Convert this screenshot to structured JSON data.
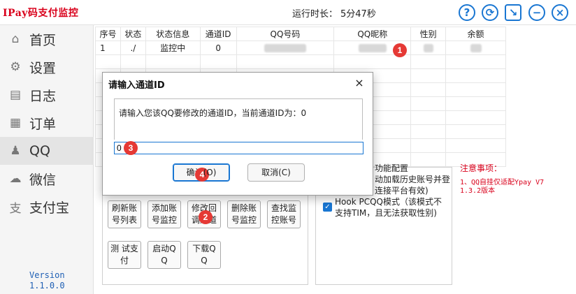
{
  "header": {
    "app_title": "IPay码支付监控",
    "runtime_label": "运行时长：",
    "runtime_value": "5分47秒",
    "buttons": {
      "help": "?",
      "refresh": "⟳",
      "minimize_tray": "↘",
      "minimize": "−",
      "close": "×"
    }
  },
  "sidebar": {
    "items": [
      {
        "label": "首页",
        "icon": "home-icon",
        "glyph": "⌂"
      },
      {
        "label": "设置",
        "icon": "gear-icon",
        "glyph": "⚙"
      },
      {
        "label": "日志",
        "icon": "log-icon",
        "glyph": "▤"
      },
      {
        "label": "订单",
        "icon": "order-icon",
        "glyph": "▦"
      },
      {
        "label": "QQ",
        "icon": "qq-icon",
        "glyph": "♟"
      },
      {
        "label": "微信",
        "icon": "wechat-icon",
        "glyph": "☁"
      },
      {
        "label": "支付宝",
        "icon": "alipay-icon",
        "glyph": "支"
      }
    ],
    "version_label": "Version",
    "version_value": "1.1.0.0"
  },
  "table": {
    "headers": [
      "序号",
      "状态",
      "状态信息",
      "通道ID",
      "QQ号码",
      "QQ昵称",
      "性别",
      "余额"
    ],
    "rows": [
      {
        "index": "1",
        "status": "./",
        "status_info": "监控中",
        "channel_id": "0"
      }
    ]
  },
  "actions": {
    "refresh_list": "刷新账号列表",
    "add_monitor": "添加账号监控",
    "modify_channel": "修改回调通道",
    "delete_monitor": "删除账号监控",
    "find_monitor": "查找监控账号",
    "test_pay": "测 试支 付",
    "start_qq": "启动Q Q",
    "download_qq": "下载Q Q"
  },
  "options": {
    "section_title": "功能配置",
    "auto_load_text": "动加载历史账号并登",
    "auto_load_text2": "连接平台有效)",
    "hook_text": "Hook PCQQ模式（该模式不支持TIM，且无法获取性别)"
  },
  "notes": {
    "title": "注意事项：",
    "body": "1、QQ自挂仅适配Ypay V7 1.3.2版本"
  },
  "dialog": {
    "title": "请输入通道ID",
    "close": "×",
    "message": "请输入您该QQ要修改的通道ID，当前通道ID为：0",
    "input_value": "0",
    "ok_label": "确认(O)",
    "ok_short": "确认",
    "ok_suffix": "(O)",
    "cancel_label": "取消(C)"
  },
  "badges": [
    "1",
    "2",
    "3",
    "4"
  ]
}
